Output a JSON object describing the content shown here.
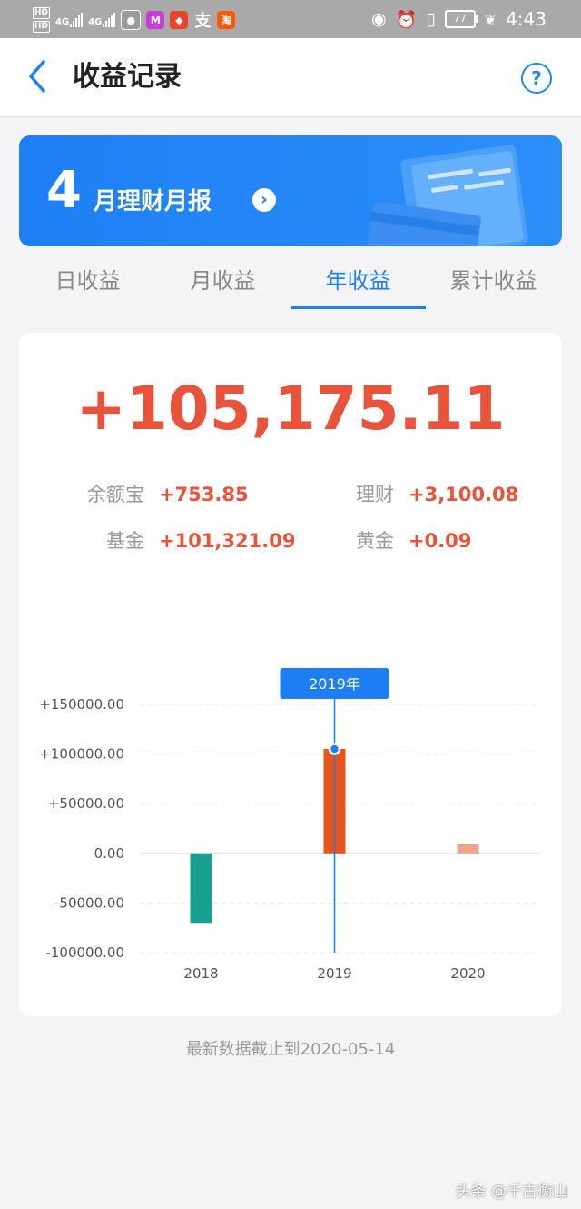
{
  "status_bar": {
    "network_labels": [
      "4G",
      "4G"
    ],
    "battery": "77",
    "time": "4:43",
    "app_icons": [
      "wechat-icon",
      "m-app-icon",
      "red-app-icon",
      "alipay-icon",
      "taobao-icon"
    ]
  },
  "nav": {
    "title": "收益记录",
    "help": "?"
  },
  "banner": {
    "month_number": "4",
    "text": "月理财月报",
    "arrow": "›"
  },
  "tabs": [
    {
      "label": "日收益",
      "active": false
    },
    {
      "label": "月收益",
      "active": false
    },
    {
      "label": "年收益",
      "active": true
    },
    {
      "label": "累计收益",
      "active": false
    }
  ],
  "summary": {
    "total": "+105,175.11",
    "items": [
      {
        "label": "余额宝",
        "value": "+753.85"
      },
      {
        "label": "理财",
        "value": "+3,100.08"
      },
      {
        "label": "基金",
        "value": "+101,321.09"
      },
      {
        "label": "黄金",
        "value": "+0.09"
      }
    ]
  },
  "chart_data": {
    "type": "bar",
    "categories": [
      "2018",
      "2019",
      "2020"
    ],
    "values": [
      -70000,
      105175.11,
      9000
    ],
    "y_ticks": [
      "+150000.00",
      "+100000.00",
      "+50000.00",
      "0.00",
      "-50000.00",
      "-100000.00"
    ],
    "y_tick_values": [
      150000,
      100000,
      50000,
      0,
      -50000,
      -100000
    ],
    "ylim": [
      -100000,
      150000
    ],
    "bar_colors": [
      "#16a08f",
      "#e8541a",
      "#f2a28a"
    ],
    "selected_index": 1,
    "tooltip": "2019年",
    "accent": "#1e7ff5",
    "grid": true
  },
  "footer": {
    "note": "最新数据截止到2020-05-14"
  },
  "watermark": "头条 @千古衡山"
}
